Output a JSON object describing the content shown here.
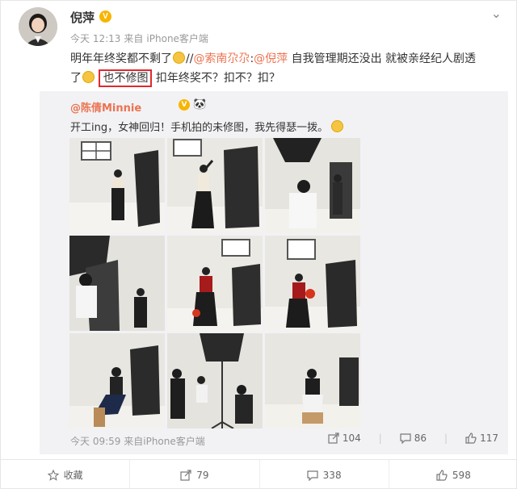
{
  "post": {
    "username": "倪萍",
    "verified_badge": "V",
    "time": "今天 12:13",
    "source_prefix": "来自",
    "source": "iPhone客户端",
    "text_part1": "明年年终奖都不剩了",
    "text_part2": "//",
    "mention1": "@索南尕尕",
    "text_part3": ":",
    "mention2": "@倪萍",
    "text_part4": " 自我管理期还没出 就被亲经纪人剧透",
    "text_part5": "了",
    "highlight": "也不修图",
    "text_part6": "扣年终奖不？扣不？扣？"
  },
  "repost": {
    "user": "@陈倩Minnie",
    "verified_badge": "V",
    "text": "开工ing，女神回归！手机拍的未修图，我先得瑟一拨。",
    "time": "今天 09:59",
    "source_prefix": "来自",
    "source": "iPhone客户端",
    "reposts": "104",
    "comments": "86",
    "likes": "117"
  },
  "footer": {
    "favorite": "收藏",
    "repost": "79",
    "comment": "338",
    "like": "598"
  },
  "photos": [
    {
      "scene": "standing-window"
    },
    {
      "scene": "pose-arm-up"
    },
    {
      "scene": "photographer-back"
    },
    {
      "scene": "photographer-left"
    },
    {
      "scene": "red-top-walk"
    },
    {
      "scene": "red-top-fan"
    },
    {
      "scene": "sitting-stool"
    },
    {
      "scene": "softbox-crew"
    },
    {
      "scene": "sitting-center"
    }
  ],
  "colors": {
    "accent": "#eb7350",
    "badge": "#f7b500",
    "highlight_box": "#e0282f",
    "repost_bg": "#f2f2f5"
  }
}
